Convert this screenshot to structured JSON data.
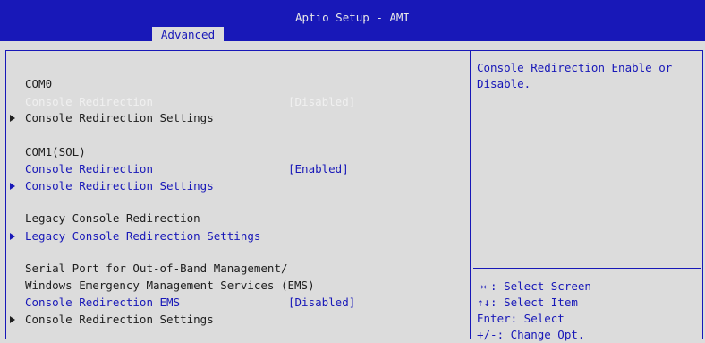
{
  "header": {
    "title": "Aptio Setup - AMI",
    "active_tab": "Advanced"
  },
  "items": [
    {
      "label": "COM0"
    },
    {
      "label": "Console Redirection",
      "value": "[Disabled]"
    },
    {
      "label": "Console Redirection Settings",
      "submenu": true
    },
    {
      "label": "COM1(SOL)"
    },
    {
      "label": "Console Redirection",
      "value": "[Enabled]"
    },
    {
      "label": "Console Redirection Settings",
      "submenu": true
    },
    {
      "label": "Legacy Console Redirection"
    },
    {
      "label": "Legacy Console Redirection Settings",
      "submenu": true
    },
    {
      "label": "Serial Port for Out-of-Band Management/"
    },
    {
      "label": "Windows Emergency Management Services (EMS)"
    },
    {
      "label": "Console Redirection EMS",
      "value": "[Disabled]"
    },
    {
      "label": "Console Redirection Settings",
      "submenu": true
    }
  ],
  "help": {
    "text": "Console Redirection Enable or Disable."
  },
  "keys": [
    "→←: Select Screen",
    "↑↓: Select Item",
    "Enter: Select",
    "+/-: Change Opt."
  ],
  "colors": {
    "header_bg": "#1818b8",
    "body_bg": "#dcdcdc",
    "selected_text": "#f0f0f0",
    "active_text": "#1818b8",
    "static_text": "#202020"
  }
}
